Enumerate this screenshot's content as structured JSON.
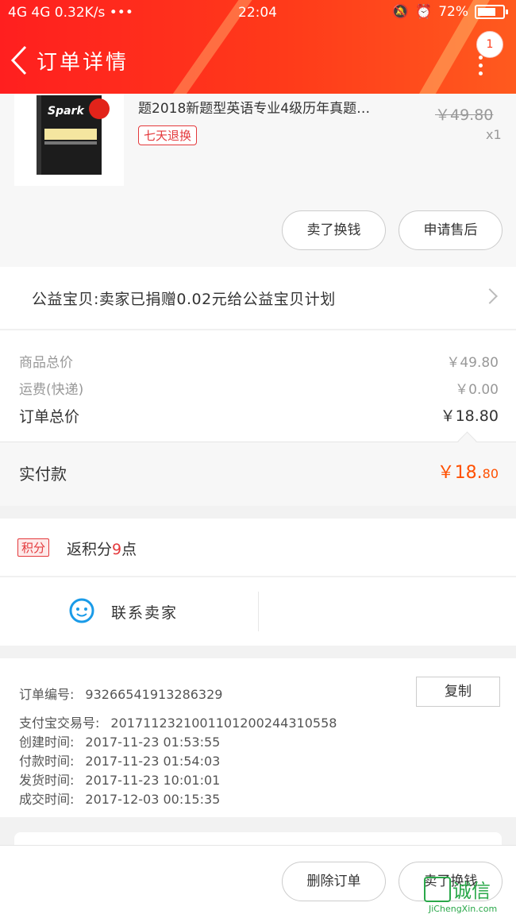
{
  "status_bar": {
    "network": "4G 4G",
    "speed": "0.32K/s •••",
    "time": "22:04",
    "battery": "72%"
  },
  "header": {
    "title": "订单详情",
    "badge_count": "1"
  },
  "product": {
    "title": "题2018新题型英语专业4级历年真题…",
    "tag": "七天退换",
    "original_price": "￥49.80",
    "quantity": "x1",
    "cover_brand": "Spark"
  },
  "product_actions": {
    "sell_label": "卖了换钱",
    "after_sale_label": "申请售后"
  },
  "charity": {
    "text": "公益宝贝:卖家已捐赠0.02元给公益宝贝计划"
  },
  "summary": {
    "goods_label": "商品总价",
    "goods_value": "￥49.80",
    "shipping_label": "运费(快递)",
    "shipping_value": "￥0.00",
    "total_label": "订单总价",
    "total_value": "￥18.80"
  },
  "paid": {
    "label": "实付款",
    "currency_int": "￥18.",
    "decimals": "80"
  },
  "points": {
    "tag": "积分",
    "prefix": "返积分",
    "value": "9",
    "suffix": "点"
  },
  "contact": {
    "label": "联系卖家"
  },
  "order_info": {
    "order_no_label": "订单编号:",
    "order_no": "93266541913286329",
    "copy_label": "复制",
    "alipay_label": "支付宝交易号:",
    "alipay_no": "2017112321001101200244310558",
    "created_label": "创建时间:",
    "created": "2017-11-23 01:53:55",
    "paid_label": "付款时间:",
    "paid": "2017-11-23 01:54:03",
    "shipped_label": "发货时间:",
    "shipped": "2017-11-23 10:01:01",
    "done_label": "成交时间:",
    "done": "2017-12-03 00:15:35"
  },
  "bottom_bar": {
    "delete_label": "删除订单",
    "sell_label": "卖了换钱"
  },
  "watermark": {
    "cn": "诚信",
    "en": "JiChengXin.com"
  },
  "colors": {
    "brand_red": "#ff3a1a",
    "accent_orange": "#ff5000",
    "tag_red": "#e4393c"
  }
}
